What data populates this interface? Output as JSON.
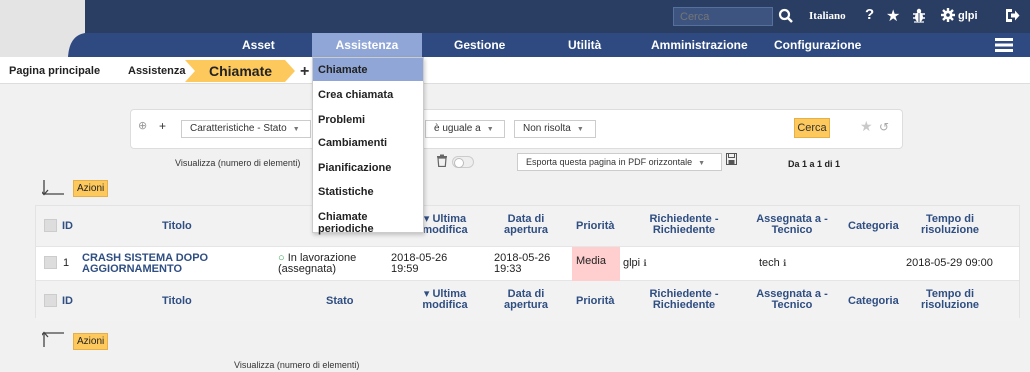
{
  "topbar": {
    "search_placeholder": "Cerca",
    "language": "Italiano",
    "help_glyph": "?",
    "user": "glpi"
  },
  "menu": {
    "items": [
      "Asset",
      "Assistenza",
      "Gestione",
      "Utilità",
      "Amministrazione",
      "Configurazione"
    ],
    "active": "Assistenza"
  },
  "breadcrumb": {
    "home": "Pagina principale",
    "section": "Assistenza",
    "current": "Chiamate",
    "add_glyph": "+"
  },
  "dropdown": {
    "items": [
      "Chiamate",
      "Crea chiamata",
      "Problemi",
      "Cambiamenti",
      "Pianificazione",
      "Statistiche",
      "Chiamate periodiche"
    ],
    "active": "Chiamate"
  },
  "criteria": {
    "field": "Caratteristiche - Stato",
    "operator": "è uguale a",
    "value": "Non risolta",
    "search_button": "Cerca"
  },
  "toolbar": {
    "display_label": "Visualizza (numero di elementi)",
    "pdf_export": "Esporta questa pagina in PDF orizzontale",
    "pager": "Da 1 a 1 di 1",
    "actions": "Azioni"
  },
  "table": {
    "headers": {
      "id": "ID",
      "title": "Titolo",
      "status": "Stato",
      "last_modified": "Ultima modifica",
      "opening_date": "Data di apertura",
      "priority": "Priorità",
      "requester": "Richiedente - Richiedente",
      "assigned": "Assegnata a - Tecnico",
      "category": "Categoria",
      "resolution_time": "Tempo di risoluzione"
    },
    "rows": [
      {
        "id": "1",
        "title": "CRASH SISTEMA DOPO AGGIORNAMENTO",
        "status": "In lavorazione (assegnata)",
        "last_modified": "2018-05-26 19:59",
        "opening_date": "2018-05-26 19:33",
        "priority": "Media",
        "requester": "glpi",
        "assigned": "tech",
        "category": "",
        "resolution_time": "2018-05-29 09:00"
      }
    ]
  },
  "colors": {
    "topbar": "#2a3d62",
    "menubar": "#2e4a80",
    "accent": "#fec95c",
    "menu_active": "#8fa6d6",
    "priority_medium": "#ffcece",
    "status_green": "#3aa655"
  }
}
